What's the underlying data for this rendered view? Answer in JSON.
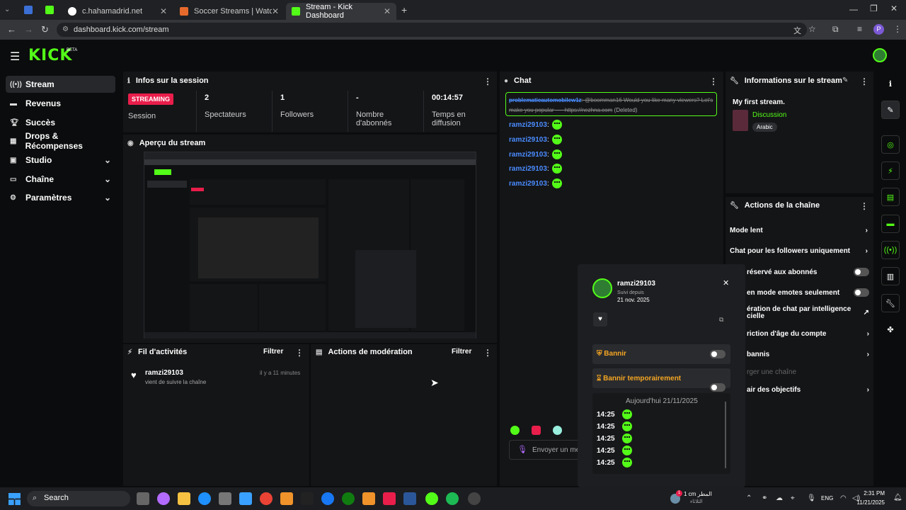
{
  "browser": {
    "tabs": [
      {
        "label": "c.hahamadrid.net",
        "color": "#53fc18"
      },
      {
        "label": "Soccer Streams | Watch Live St",
        "color": "#e66a2c"
      },
      {
        "label": "Stream - Kick Dashboard",
        "color": "#53fc18"
      }
    ],
    "url": "dashboard.kick.com/stream",
    "profile_initial": "P"
  },
  "brand": {
    "logo": "KICK",
    "beta": "BETA",
    "accent": "#53fc18"
  },
  "sidebar": {
    "items": [
      {
        "label": "Stream",
        "icon": "broadcast-icon"
      },
      {
        "label": "Revenus",
        "icon": "money-icon"
      },
      {
        "label": "Succès",
        "icon": "trophy-icon"
      },
      {
        "label": "Drops & Récompenses",
        "icon": "gift-icon"
      },
      {
        "label": "Studio",
        "icon": "studio-icon"
      },
      {
        "label": "Chaîne",
        "icon": "channel-icon"
      },
      {
        "label": "Paramètres",
        "icon": "gear-icon"
      }
    ]
  },
  "session": {
    "title": "Infos sur la session",
    "streaming_badge": "STREAMING",
    "stats": [
      {
        "value": "",
        "label": "Session"
      },
      {
        "value": "2",
        "label": "Spectateurs"
      },
      {
        "value": "1",
        "label": "Followers"
      },
      {
        "value": "-",
        "label": "Nombre d'abonnés"
      },
      {
        "value": "00:14:57",
        "label": "Temps en diffusion"
      }
    ]
  },
  "preview": {
    "title": "Aperçu du stream"
  },
  "activity": {
    "title": "Fil d'activités",
    "filter": "Filtrer",
    "items": [
      {
        "user": "ramzi29103",
        "text": "vient de suivre la chaîne",
        "time": "il y a 11 minutes"
      }
    ]
  },
  "moderation": {
    "title": "Actions de modération",
    "filter": "Filtrer"
  },
  "chat": {
    "title": "Chat",
    "deleted_message": {
      "user": "problematicautomobilew1z",
      "text": "@boomman16 Would you like many viewers? Let's make you popular ---- https://nezhna.com",
      "tag": "(Deleted)"
    },
    "messages": [
      {
        "user": "ramzi29103"
      },
      {
        "user": "ramzi29103"
      },
      {
        "user": "ramzi29103"
      },
      {
        "user": "ramzi29103"
      },
      {
        "user": "ramzi29103"
      }
    ],
    "input_placeholder": "Envoyer un me"
  },
  "stream_info": {
    "title": "Informations sur le stream",
    "stream_title": "My first stream.",
    "category": "Discussion",
    "language": "Arabic"
  },
  "channel_actions": {
    "title": "Actions de la chaîne",
    "items": [
      {
        "label": "Mode lent",
        "control": "chevron"
      },
      {
        "label": "Chat pour les followers uniquement",
        "control": "chevron"
      },
      {
        "label": "réservé aux abonnés",
        "control": "toggle"
      },
      {
        "label": "en mode emotes seulement",
        "control": "toggle"
      },
      {
        "label": "ération de chat par intelligence\ncielle",
        "control": "external"
      },
      {
        "label": "riction d'âge du compte",
        "control": "chevron"
      },
      {
        "label": "bannis",
        "control": "chevron"
      },
      {
        "label": "rger une chaîne",
        "control": "none"
      },
      {
        "label": "air des objectifs",
        "control": "chevron"
      }
    ]
  },
  "user_popup": {
    "username": "ramzi29103",
    "followed_label": "Suivi depuis",
    "followed_date": "21 nov. 2025",
    "ban_label": "Bannir",
    "timeout_label": "Bannir temporairement",
    "date_header": "Aujourd'hui 21/11/2025",
    "times": [
      "14:25",
      "14:25",
      "14:25",
      "14:25",
      "14:25"
    ]
  },
  "taskbar": {
    "search": "Search",
    "weather_line1": "1 cm المطر",
    "weather_line2": "الثلاثاء",
    "lang": "ENG",
    "time": "2:31 PM",
    "date": "11/21/2025",
    "weather_badge": "1"
  }
}
